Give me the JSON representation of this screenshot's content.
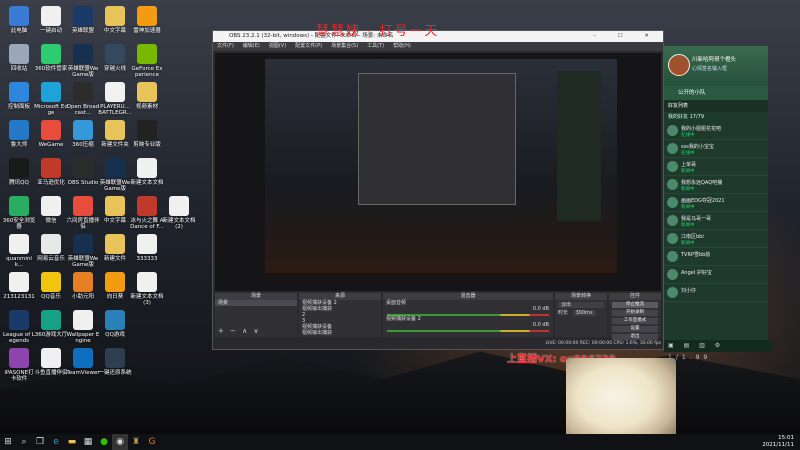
{
  "desktop_icons": [
    {
      "label": "此电脑",
      "icon": "computer-icon",
      "color": "#3a7bd5",
      "col": 0,
      "row": 0
    },
    {
      "label": "一键启动",
      "icon": "doc-icon",
      "color": "#f0f0f0",
      "col": 1,
      "row": 0
    },
    {
      "label": "英雄联盟",
      "icon": "lol-icon",
      "color": "#1a3a6a",
      "col": 2,
      "row": 0
    },
    {
      "label": "中文字幕",
      "icon": "folder-icon",
      "color": "#e8c35a",
      "col": 3,
      "row": 0
    },
    {
      "label": "雷神加速器",
      "icon": "thunder-icon",
      "color": "#f39c12",
      "col": 4,
      "row": 0
    },
    {
      "label": "回收站",
      "icon": "recycle-icon",
      "color": "#9aa7b8",
      "col": 0,
      "row": 1
    },
    {
      "label": "360软件管家",
      "icon": "360-icon",
      "color": "#2ecc71",
      "col": 1,
      "row": 1
    },
    {
      "label": "英雄联盟WeGame版",
      "icon": "game-icon",
      "color": "#18304f",
      "col": 2,
      "row": 1
    },
    {
      "label": "穿越火线",
      "icon": "cf-icon",
      "color": "#34495e",
      "col": 3,
      "row": 1
    },
    {
      "label": "GeForce Experience",
      "icon": "nvidia-icon",
      "color": "#76b900",
      "col": 4,
      "row": 1
    },
    {
      "label": "控制面板",
      "icon": "panel-icon",
      "color": "#2e86de",
      "col": 0,
      "row": 2
    },
    {
      "label": "Microsoft Edge",
      "icon": "edge-icon",
      "color": "#1fa2d8",
      "col": 1,
      "row": 2
    },
    {
      "label": "Open Broadcast...",
      "icon": "obs-icon",
      "color": "#2c2c2c",
      "col": 2,
      "row": 2
    },
    {
      "label": "PLAYERU... BATTLEGR...",
      "icon": "pubg-icon",
      "color": "#f1f1f1",
      "col": 3,
      "row": 2
    },
    {
      "label": "视频素材",
      "icon": "folder-icon",
      "color": "#e8c35a",
      "col": 4,
      "row": 2
    },
    {
      "label": "鲁大师",
      "icon": "master-icon",
      "color": "#2478c8",
      "col": 0,
      "row": 3
    },
    {
      "label": "WeGame",
      "icon": "wegame-icon",
      "color": "#e74c3c",
      "col": 1,
      "row": 3
    },
    {
      "label": "360压缩",
      "icon": "zip-icon",
      "color": "#3498db",
      "col": 2,
      "row": 3
    },
    {
      "label": "新建文件夹",
      "icon": "folder-icon",
      "color": "#e8c35a",
      "col": 3,
      "row": 3
    },
    {
      "label": "剪映专业版",
      "icon": "capcut-icon",
      "color": "#222222",
      "col": 4,
      "row": 3
    },
    {
      "label": "腾讯QQ",
      "icon": "qq-icon",
      "color": "#1a1a1a",
      "col": 0,
      "row": 4
    },
    {
      "label": "亚马逊优化",
      "icon": "app-icon",
      "color": "#c0392b",
      "col": 1,
      "row": 4
    },
    {
      "label": "OBS Studio",
      "icon": "obs-icon",
      "color": "#2c2c2c",
      "col": 2,
      "row": 4
    },
    {
      "label": "英雄联盟WeGame版",
      "icon": "game-icon",
      "color": "#18304f",
      "col": 3,
      "row": 4
    },
    {
      "label": "新建文本文档",
      "icon": "doc-icon",
      "color": "#f0f0f0",
      "col": 4,
      "row": 4
    },
    {
      "label": "360安全浏览器",
      "icon": "browser-icon",
      "color": "#27ae60",
      "col": 0,
      "row": 5
    },
    {
      "label": "微信",
      "icon": "wechat-icon",
      "color": "#f0f0f0",
      "col": 1,
      "row": 5
    },
    {
      "label": "六间房直播伴侣",
      "icon": "live-icon",
      "color": "#e74c3c",
      "col": 2,
      "row": 5
    },
    {
      "label": "中文字幕",
      "icon": "folder-icon",
      "color": "#e8c35a",
      "col": 3,
      "row": 5
    },
    {
      "label": "冰与火之舞 A Dance of F...",
      "icon": "dance-icon",
      "color": "#c0392b",
      "col": 4,
      "row": 5
    },
    {
      "label": "新建文本文档(2)",
      "icon": "doc-icon",
      "color": "#f0f0f0",
      "col": 5,
      "row": 5
    },
    {
      "label": "quanminlk...",
      "icon": "doc-icon",
      "color": "#f0f0f0",
      "col": 0,
      "row": 6
    },
    {
      "label": "网易云音乐",
      "icon": "music-icon",
      "color": "#e8e8e8",
      "col": 1,
      "row": 6
    },
    {
      "label": "英雄联盟WeGame版",
      "icon": "game-icon",
      "color": "#18304f",
      "col": 2,
      "row": 6
    },
    {
      "label": "新建文件",
      "icon": "folder-icon",
      "color": "#e8c35a",
      "col": 3,
      "row": 6
    },
    {
      "label": "333333",
      "icon": "doc-icon",
      "color": "#f0f0f0",
      "col": 4,
      "row": 6
    },
    {
      "label": "213123131",
      "icon": "doc-icon",
      "color": "#f0f0f0",
      "col": 0,
      "row": 7
    },
    {
      "label": "QQ音乐",
      "icon": "qqmusic-icon",
      "color": "#f1c40f",
      "col": 1,
      "row": 7
    },
    {
      "label": "小助元阳",
      "icon": "app-icon",
      "color": "#e67e22",
      "col": 2,
      "row": 7
    },
    {
      "label": "向日葵",
      "icon": "sunflower-icon",
      "color": "#f39c12",
      "col": 3,
      "row": 7
    },
    {
      "label": "新建文本文档(3)",
      "icon": "doc-icon",
      "color": "#f0f0f0",
      "col": 4,
      "row": 7
    },
    {
      "label": "League of Legends",
      "icon": "lol-icon",
      "color": "#1a3a6a",
      "col": 0,
      "row": 8
    },
    {
      "label": "360游戏大厅",
      "icon": "360game-icon",
      "color": "#16a085",
      "col": 1,
      "row": 8
    },
    {
      "label": "Wallpaper Engine",
      "icon": "doc-icon",
      "color": "#f0f0f0",
      "col": 2,
      "row": 8
    },
    {
      "label": "QQ游戏",
      "icon": "qqgame-icon",
      "color": "#2980b9",
      "col": 3,
      "row": 8
    },
    {
      "label": "iPASONE打卡软件",
      "icon": "app-icon",
      "color": "#8e44ad",
      "col": 0,
      "row": 9
    },
    {
      "label": "斗鱼直播伴侣",
      "icon": "douyu-icon",
      "color": "#f0f0f0",
      "col": 1,
      "row": 9
    },
    {
      "label": "TeamViewer",
      "icon": "teamviewer-icon",
      "color": "#0e6ebf",
      "col": 2,
      "row": 9
    },
    {
      "label": "一键还原系统",
      "icon": "restore-icon",
      "color": "#2c3e50",
      "col": 3,
      "row": 9
    }
  ],
  "obs": {
    "title": "OBS 23.2.1 (32-bit, windows) - 配置文件: 未命名 - 场景: 未命名",
    "menu": [
      "文件(F)",
      "编辑(E)",
      "视图(V)",
      "配置文件(P)",
      "场景集合(S)",
      "工具(T)",
      "帮助(H)"
    ],
    "docks": {
      "scenes": {
        "title": "场景",
        "items": [
          "场景"
        ]
      },
      "sources": {
        "title": "来源",
        "items": [
          "视频捕获设备 2",
          "视频输出捕获",
          "2",
          "3",
          "视频捕获设备",
          "视频输出捕获"
        ]
      },
      "mixer": {
        "title": "混音器",
        "ch1": "桌面音频",
        "ch1_db": "0.0 dB",
        "ch2": "视频捕获设备 2",
        "ch2_db": "0.0 dB"
      },
      "transitions": {
        "title": "场景转换",
        "type": "淡出",
        "duration_label": "时长",
        "duration": "300ms"
      },
      "controls": {
        "title": "控件",
        "buttons": [
          "停止推流",
          "开始录制",
          "工作室模式",
          "设置",
          "退出"
        ]
      }
    },
    "status": "LIVE: 00:00:00    REC: 00:00:00    CPU: 1.6%, 30.00 fps"
  },
  "overlay": {
    "top_text": "慧慧姨 · 打号一天",
    "wx_text": "上直播VX: ou996729"
  },
  "qq": {
    "name": "川新哈阿哥个橙头",
    "status": "心情签名输入框",
    "section": "公开的小队",
    "friends_header": "好友列表",
    "group_header": "我的好友 17/79",
    "rows": [
      {
        "name": "我的小姐姐花花吧",
        "state": "在线中"
      },
      {
        "name": "sss我的小宝宝",
        "state": "在线中"
      },
      {
        "name": "上单哥",
        "state": "新闻中"
      },
      {
        "name": "我想永远QAQ吧播",
        "state": "新闻中"
      },
      {
        "name": "画画EDG夺冠2021",
        "state": "新闻中"
      },
      {
        "name": "我是马哥一哥",
        "state": "新闻中"
      },
      {
        "name": "江南区bbi",
        "state": "新闻中"
      },
      {
        "name": "TVRP雪bb前",
        "state": ""
      },
      {
        "name": "Angel 护好宝",
        "state": ""
      },
      {
        "name": "刘小仔",
        "state": ""
      }
    ],
    "bottom_count": "1/1.99"
  },
  "taskbar": {
    "time": "15:01",
    "date": "2021/11/11"
  }
}
